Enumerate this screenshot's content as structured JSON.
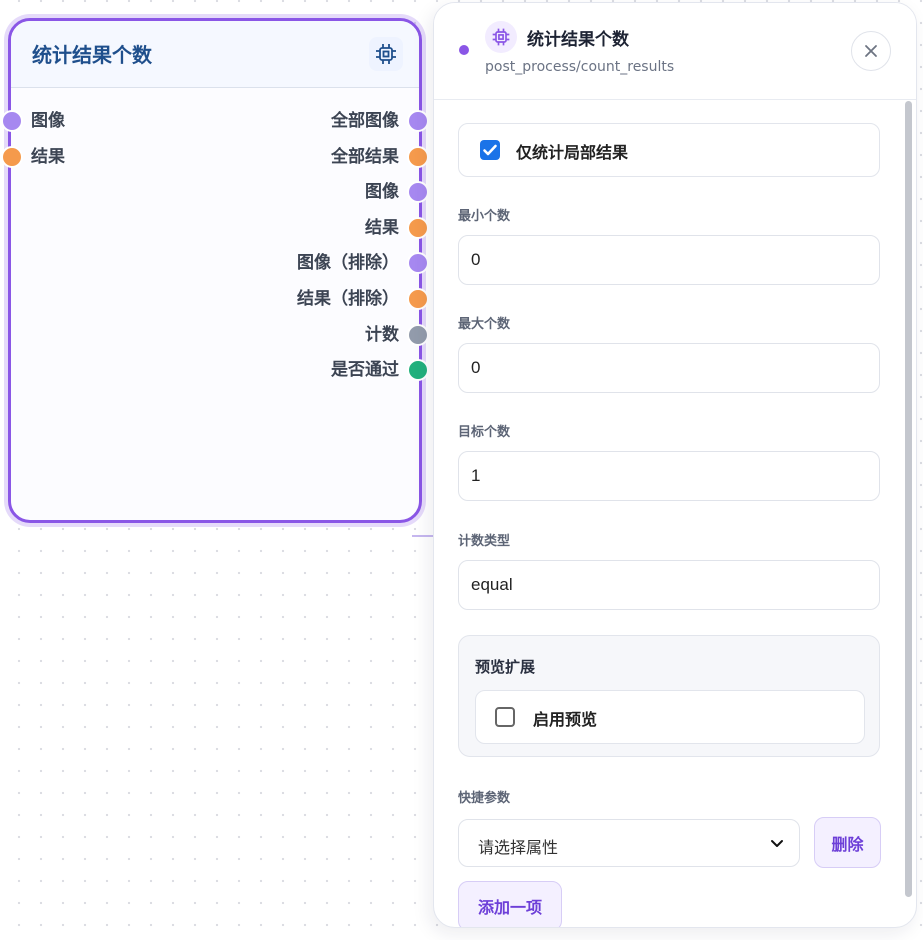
{
  "node": {
    "title": "统计结果个数",
    "inputs": [
      {
        "label": "图像",
        "color": "#a688f0"
      },
      {
        "label": "结果",
        "color": "#f59a4c"
      }
    ],
    "outputs": [
      {
        "label": "全部图像",
        "color": "#a688f0"
      },
      {
        "label": "全部结果",
        "color": "#f59a4c"
      },
      {
        "label": "图像",
        "color": "#a688f0"
      },
      {
        "label": "结果",
        "color": "#f59a4c"
      },
      {
        "label": "图像（排除）",
        "color": "#a688f0"
      },
      {
        "label": "结果（排除）",
        "color": "#f59a4c"
      },
      {
        "label": "计数",
        "color": "#929bab"
      },
      {
        "label": "是否通过",
        "color": "#22b07d"
      }
    ]
  },
  "panel": {
    "title": "统计结果个数",
    "subtitle": "post_process/count_results",
    "close_icon": "close-icon",
    "local_only": {
      "label": "仅统计局部结果",
      "checked": true
    },
    "fields": {
      "min_count": {
        "label": "最小个数",
        "value": "0"
      },
      "max_count": {
        "label": "最大个数",
        "value": "0"
      },
      "target_count": {
        "label": "目标个数",
        "value": "1"
      },
      "count_type": {
        "label": "计数类型",
        "value": "equal"
      }
    },
    "preview": {
      "title": "预览扩展",
      "enable": {
        "label": "启用预览",
        "checked": false
      }
    },
    "quick_params": {
      "label": "快捷参数",
      "select_value": "请选择属性",
      "delete_label": "删除",
      "add_label": "添加一项"
    }
  },
  "colors": {
    "accent": "#8a56e6",
    "title_blue": "#1f4f8c",
    "checkbox_blue": "#1a73e8"
  }
}
